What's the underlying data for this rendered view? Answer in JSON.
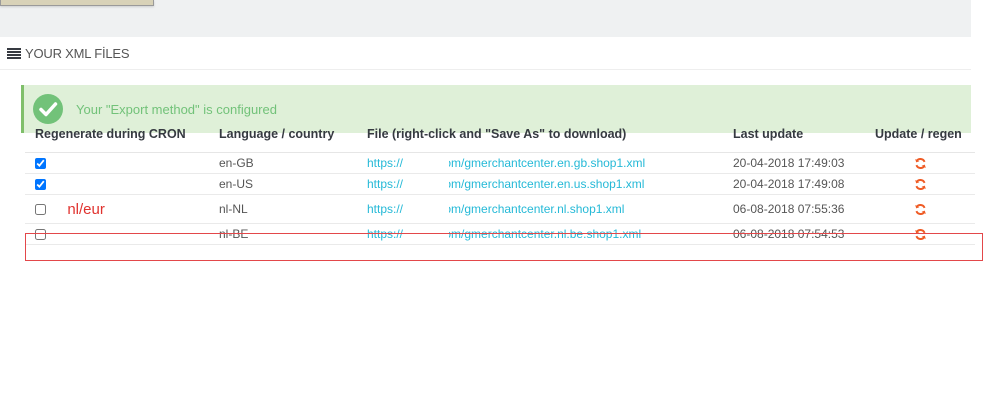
{
  "panel": {
    "title": "YOUR XML FİLES"
  },
  "alert": {
    "message": "Your \"Export method\" is configured"
  },
  "table": {
    "headers": [
      "Regenerate during CRON",
      "Language / country",
      "File (right-click and \"Save As\" to download)",
      "Last update",
      "Update / regen"
    ],
    "rows": [
      {
        "checked": true,
        "language": "en-GB",
        "url_start": "https://",
        "url_end": ").com/gmerchantcenter.en.gb.shop1.xml",
        "updated": "20-04-2018 17:49:03",
        "note": ""
      },
      {
        "checked": true,
        "language": "en-US",
        "url_start": "https://",
        "url_end": ").com/gmerchantcenter.en.us.shop1.xml",
        "updated": "20-04-2018 17:49:08",
        "note": ""
      },
      {
        "checked": false,
        "language": "nl-NL",
        "url_start": "https://",
        "url_end": ").com/gmerchantcenter.nl.shop1.xml",
        "updated": "06-08-2018 07:55:36",
        "note": "nl/eur"
      },
      {
        "checked": false,
        "language": "nl-BE",
        "url_start": "https://",
        "url_end": ").com/gmerchantcenter.nl.be.shop1.xml",
        "updated": "06-08-2018 07:54:53",
        "note": ""
      }
    ]
  },
  "icons": {
    "panel": "list-icon",
    "alert": "check-circle-icon",
    "action": "refresh-icon"
  },
  "colors": {
    "link": "#25b9d7",
    "success_bg": "#dff0d8",
    "success_text": "#72c279",
    "refresh": "#ef5b25",
    "annotation": "#e0322e"
  }
}
